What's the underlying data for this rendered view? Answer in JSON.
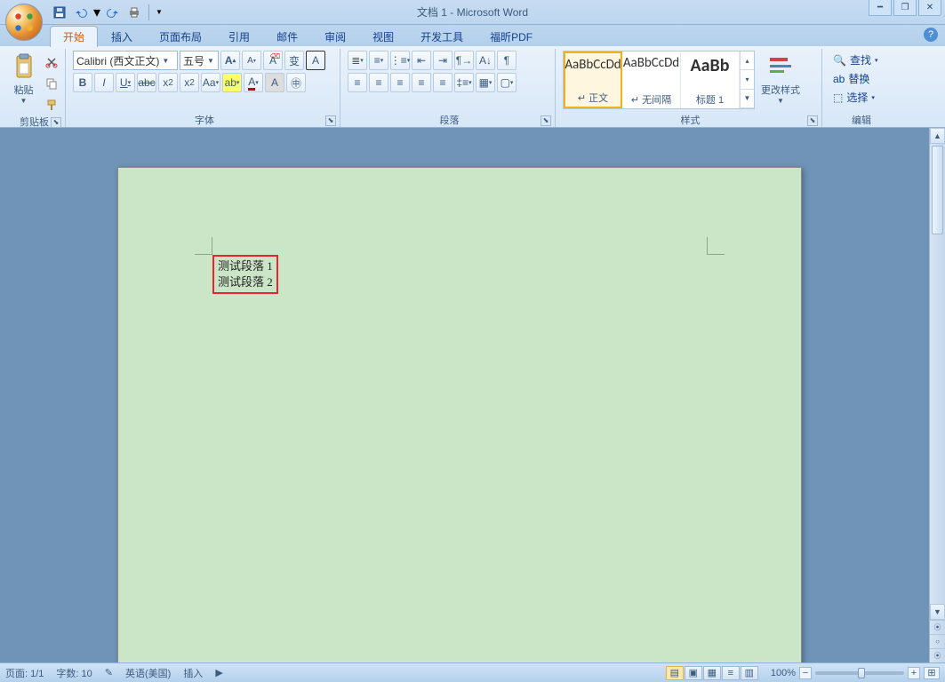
{
  "window": {
    "title": "文档 1 - Microsoft Word"
  },
  "qat": {
    "save": "保存",
    "undo": "撤销",
    "redo": "重做",
    "print": "打印"
  },
  "tabs": [
    "开始",
    "插入",
    "页面布局",
    "引用",
    "邮件",
    "审阅",
    "视图",
    "开发工具",
    "福昕PDF"
  ],
  "active_tab": 0,
  "ribbon": {
    "clipboard": {
      "label": "剪贴板",
      "paste": "粘贴"
    },
    "font": {
      "label": "字体",
      "family": "Calibri (西文正文)",
      "size": "五号",
      "bold": "B",
      "italic": "I",
      "underline": "U",
      "strike": "abc",
      "sub": "x₂",
      "sup": "x²",
      "case": "Aa",
      "highlight": "ab",
      "color": "A",
      "grow": "A",
      "shrink": "A",
      "clear": "Aa",
      "phonetic": "变",
      "border": "A",
      "charshading": "A"
    },
    "paragraph": {
      "label": "段落"
    },
    "styles": {
      "label": "样式",
      "items": [
        {
          "preview": "AaBbCcDd",
          "name": "↵ 正文"
        },
        {
          "preview": "AaBbCcDd",
          "name": "↵ 无间隔"
        },
        {
          "preview": "AaBb",
          "name": "标题 1"
        }
      ],
      "change": "更改样式"
    },
    "editing": {
      "label": "编辑",
      "find": "查找",
      "replace": "替换",
      "select": "选择"
    }
  },
  "document": {
    "paragraphs": [
      "测试段落 1",
      "测试段落 2"
    ]
  },
  "status": {
    "page": "页面: 1/1",
    "words": "字数: 10",
    "lang": "英语(美国)",
    "mode": "插入",
    "zoom": "100%"
  }
}
